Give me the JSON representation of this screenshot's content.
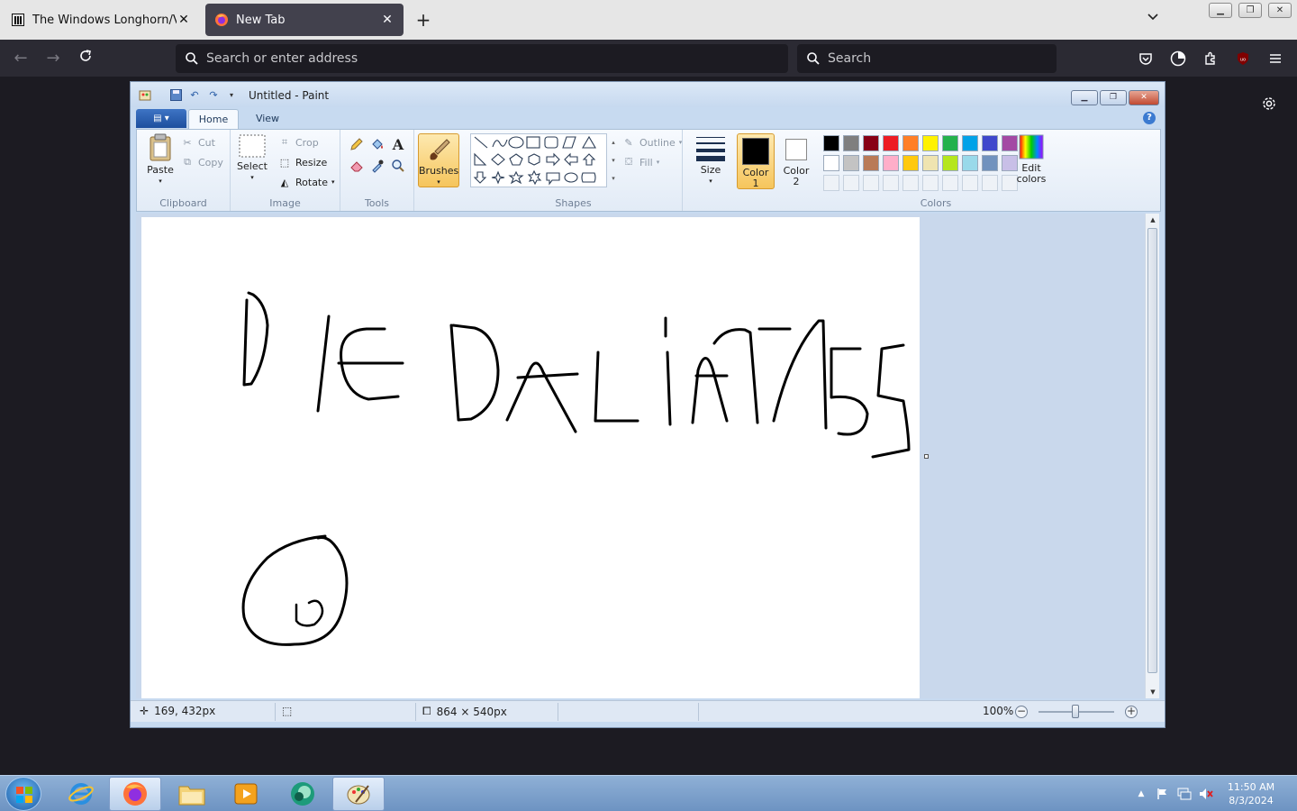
{
  "browser": {
    "tabs": [
      {
        "title": "The Windows Longhorn/Vista A",
        "active": false
      },
      {
        "title": "New Tab",
        "active": true
      }
    ],
    "address_placeholder": "Search or enter address",
    "search_placeholder": "Search"
  },
  "paint": {
    "title": "Untitled - Paint",
    "tabs": [
      "Home",
      "View"
    ],
    "clipboard": {
      "label": "Clipboard",
      "paste": "Paste",
      "cut": "Cut",
      "copy": "Copy"
    },
    "image": {
      "label": "Image",
      "select": "Select",
      "crop": "Crop",
      "resize": "Resize",
      "rotate": "Rotate"
    },
    "tools": {
      "label": "Tools"
    },
    "brushes": "Brushes",
    "shapes": {
      "label": "Shapes",
      "outline": "Outline",
      "fill": "Fill"
    },
    "size": "Size",
    "color1": {
      "line1": "Color",
      "line2": "1"
    },
    "color2": {
      "line1": "Color",
      "line2": "2"
    },
    "colors_label": "Colors",
    "edit_colors": {
      "line1": "Edit",
      "line2": "colors"
    },
    "palette_row1": [
      "#000000",
      "#7f7f7f",
      "#880015",
      "#ed1c24",
      "#ff7f27",
      "#fff200",
      "#22b14c",
      "#00a2e8",
      "#3f48cc",
      "#a349a4"
    ],
    "palette_row2": [
      "#ffffff",
      "#c3c3c3",
      "#b97a57",
      "#ffaec9",
      "#ffc90e",
      "#efe4b0",
      "#b5e61d",
      "#99d9ea",
      "#7092be",
      "#c8bfe7"
    ],
    "status": {
      "cursor_pos": "169, 432px",
      "image_size": "864 × 540px",
      "zoom": "100%"
    }
  },
  "taskbar": {
    "time": "11:50 AM",
    "date": "8/3/2024"
  }
}
